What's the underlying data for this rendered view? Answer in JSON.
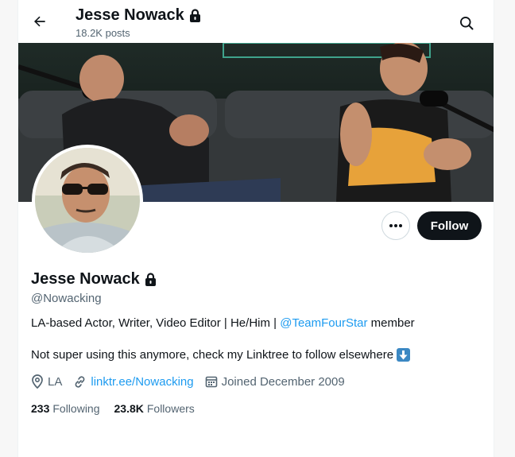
{
  "header": {
    "title": "Jesse Nowack",
    "posts_count": "18.2K posts"
  },
  "profile": {
    "name": "Jesse Nowack",
    "handle": "@Nowacking",
    "bio_prefix": "LA-based Actor, Writer, Video Editor | He/Him |",
    "bio_mention": "@TeamFourStar",
    "bio_suffix": "member",
    "bio_line2": "Not super using this anymore, check my Linktree to follow elsewhere",
    "location": "LA",
    "website": "linktr.ee/Nowacking",
    "joined": "Joined December 2009",
    "following_count": "233",
    "following_label": "Following",
    "followers_count": "23.8K",
    "followers_label": "Followers"
  },
  "actions": {
    "follow_label": "Follow"
  },
  "icons": {
    "back": "arrow-left-icon",
    "search": "search-icon",
    "lock": "lock-icon",
    "more": "more-icon",
    "location": "location-pin-icon",
    "link": "link-icon",
    "calendar": "calendar-icon",
    "down_arrow_emoji": "down-arrow-emoji-icon"
  },
  "colors": {
    "accent": "#1d9bf0",
    "text_primary": "#0f1419",
    "text_secondary": "#536471",
    "follow_bg": "#0f1419"
  }
}
